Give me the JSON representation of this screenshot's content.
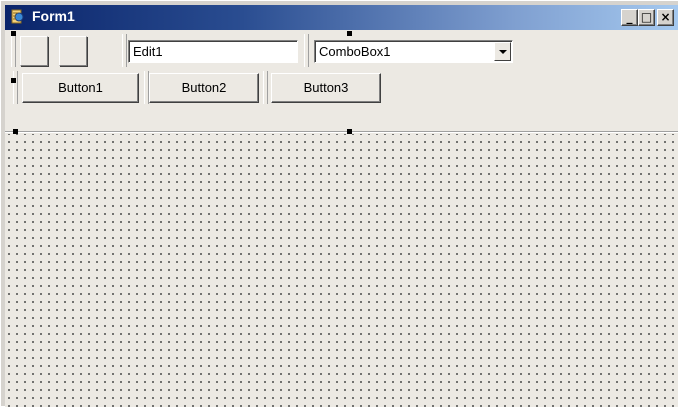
{
  "window": {
    "title": "Form1",
    "icon": "delphi-form-icon",
    "caption_buttons": {
      "minimize": "_",
      "maximize": "□",
      "close": "×"
    }
  },
  "coolbar": {
    "toolbar_buttons": [
      {
        "icon": "blank-toolbar-button"
      },
      {
        "icon": "blank-toolbar-button"
      }
    ],
    "edit": {
      "value": "Edit1"
    },
    "combobox": {
      "value": "ComboBox1"
    },
    "buttons": [
      {
        "label": "Button1"
      },
      {
        "label": "Button2"
      },
      {
        "label": "Button3"
      }
    ]
  },
  "design_surface": {
    "grid_visible": true
  }
}
